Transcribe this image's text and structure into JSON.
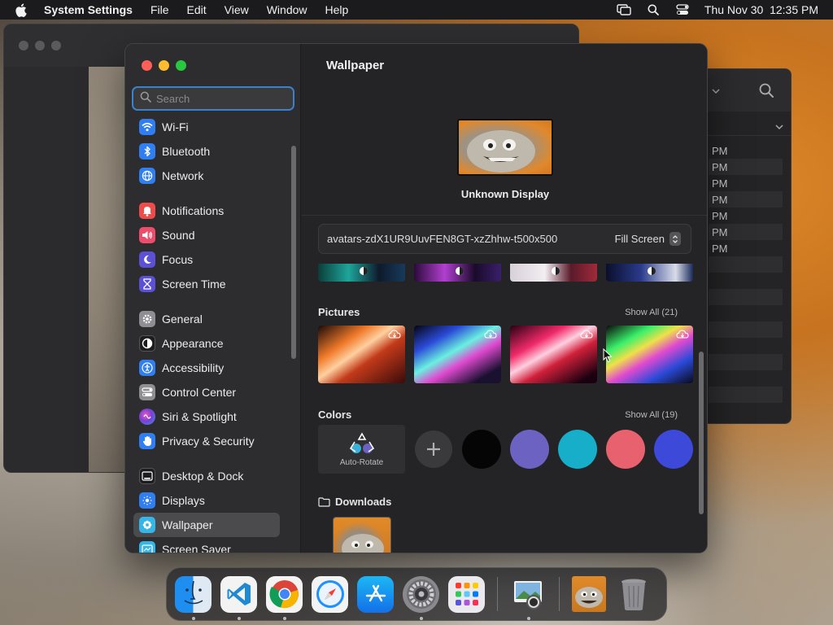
{
  "menubar": {
    "app_name": "System Settings",
    "menus": [
      "File",
      "Edit",
      "View",
      "Window",
      "Help"
    ],
    "datetime": "Thu Nov 30  12:35 PM"
  },
  "bg_window": {
    "rows": [
      "PM",
      "PM",
      "PM",
      "PM",
      "PM",
      "PM",
      "PM"
    ]
  },
  "sidebar": {
    "search_placeholder": "Search",
    "groups": [
      [
        {
          "label": "Wi-Fi",
          "icon": "wifi-icon",
          "color": "#2f7ff3"
        },
        {
          "label": "Bluetooth",
          "icon": "bluetooth-icon",
          "color": "#2f7ff3"
        },
        {
          "label": "Network",
          "icon": "globe-icon",
          "color": "#2f7ff3"
        }
      ],
      [
        {
          "label": "Notifications",
          "icon": "bell-icon",
          "color": "#ef4b4b"
        },
        {
          "label": "Sound",
          "icon": "speaker-icon",
          "color": "#ef4b6a"
        },
        {
          "label": "Focus",
          "icon": "moon-icon",
          "color": "#5b50d6"
        },
        {
          "label": "Screen Time",
          "icon": "hourglass-icon",
          "color": "#5b50d6"
        }
      ],
      [
        {
          "label": "General",
          "icon": "gear-icon",
          "color": "#8e8e93"
        },
        {
          "label": "Appearance",
          "icon": "appearance-icon",
          "color": "#1c1c1e"
        },
        {
          "label": "Accessibility",
          "icon": "accessibility-icon",
          "color": "#2f7ff3"
        },
        {
          "label": "Control Center",
          "icon": "control-center-icon",
          "color": "#8e8e93"
        },
        {
          "label": "Siri & Spotlight",
          "icon": "siri-icon",
          "color": "#7a3fd6"
        },
        {
          "label": "Privacy & Security",
          "icon": "hand-icon",
          "color": "#2f7ff3"
        }
      ],
      [
        {
          "label": "Desktop & Dock",
          "icon": "dock-icon",
          "color": "#1c1c1e"
        },
        {
          "label": "Displays",
          "icon": "displays-icon",
          "color": "#2f7ff3"
        },
        {
          "label": "Wallpaper",
          "icon": "wallpaper-icon",
          "color": "#35b6e8",
          "selected": true
        },
        {
          "label": "Screen Saver",
          "icon": "screensaver-icon",
          "color": "#35b6e8"
        }
      ]
    ]
  },
  "content": {
    "title": "Wallpaper",
    "display_name": "Unknown Display",
    "current_wallpaper": "avatars-zdX1UR9UuvFEN8GT-xzZhhw-t500x500",
    "fit_mode": "Fill Screen",
    "pictures_label": "Pictures",
    "pictures_show_all": "Show All (21)",
    "colors_label": "Colors",
    "colors_show_all": "Show All (19)",
    "auto_rotate_label": "Auto-Rotate",
    "swatches": [
      "#050505",
      "#6b62c2",
      "#17aec9",
      "#e8616e",
      "#3d49d8"
    ],
    "downloads_label": "Downloads"
  },
  "dock": {
    "apps": [
      {
        "name": "Finder",
        "icon": "finder-icon",
        "running": true
      },
      {
        "name": "Visual Studio Code",
        "icon": "vscode-icon",
        "running": true
      },
      {
        "name": "Google Chrome",
        "icon": "chrome-icon",
        "running": true
      },
      {
        "name": "Safari",
        "icon": "safari-icon",
        "running": false
      },
      {
        "name": "App Store",
        "icon": "appstore-icon",
        "running": false
      },
      {
        "name": "System Settings",
        "icon": "settings-icon",
        "running": true
      },
      {
        "name": "Launchpad",
        "icon": "launchpad-icon",
        "running": false
      }
    ],
    "docs": [
      {
        "name": "Preview",
        "icon": "preview-icon",
        "running": true
      },
      {
        "name": "Downloaded image",
        "icon": "image-file-icon"
      },
      {
        "name": "Trash",
        "icon": "trash-icon"
      }
    ]
  }
}
